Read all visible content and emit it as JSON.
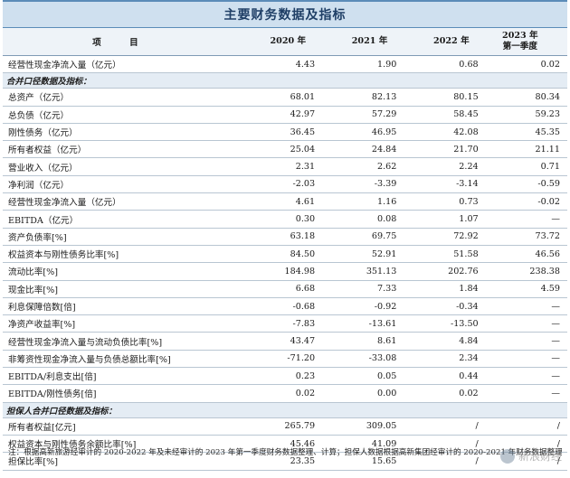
{
  "title": "主要财务数据及指标",
  "header": {
    "item": "项 目",
    "years": [
      "2020 年",
      "2021 年",
      "2022 年"
    ],
    "q_line1": "2023 年",
    "q_line2": "第一季度"
  },
  "top_row": {
    "label": "经营性现金净流入量（亿元）",
    "values": [
      "4.43",
      "1.90",
      "0.68",
      "0.02"
    ]
  },
  "section1": "合并口径数据及指标：",
  "group_a": [
    {
      "label": "总资产（亿元）",
      "values": [
        "68.01",
        "82.13",
        "80.15",
        "80.34"
      ]
    },
    {
      "label": "总负债（亿元）",
      "values": [
        "42.97",
        "57.29",
        "58.45",
        "59.23"
      ]
    },
    {
      "label": "刚性债务（亿元）",
      "values": [
        "36.45",
        "46.95",
        "42.08",
        "45.35"
      ]
    },
    {
      "label": "所有者权益（亿元）",
      "values": [
        "25.04",
        "24.84",
        "21.70",
        "21.11"
      ]
    },
    {
      "label": "营业收入（亿元）",
      "values": [
        "2.31",
        "2.62",
        "2.24",
        "0.71"
      ]
    },
    {
      "label": "净利润（亿元）",
      "values": [
        "-2.03",
        "-3.39",
        "-3.14",
        "-0.59"
      ]
    },
    {
      "label": "经营性现金净流入量（亿元）",
      "values": [
        "4.61",
        "1.16",
        "0.73",
        "-0.02"
      ]
    },
    {
      "label": "EBITDA（亿元）",
      "values": [
        "0.30",
        "0.08",
        "1.07",
        "—"
      ]
    }
  ],
  "group_b": [
    {
      "label": "资产负债率[%]",
      "values": [
        "63.18",
        "69.75",
        "72.92",
        "73.72"
      ]
    },
    {
      "label": "权益资本与刚性债务比率[%]",
      "values": [
        "84.50",
        "52.91",
        "51.58",
        "46.56"
      ]
    },
    {
      "label": "流动比率[%]",
      "values": [
        "184.98",
        "351.13",
        "202.76",
        "238.38"
      ]
    },
    {
      "label": "现金比率[%]",
      "values": [
        "6.68",
        "7.33",
        "1.84",
        "4.59"
      ]
    },
    {
      "label": "利息保障倍数[倍]",
      "values": [
        "-0.68",
        "-0.92",
        "-0.34",
        "—"
      ]
    },
    {
      "label": "净资产收益率[%]",
      "values": [
        "-7.83",
        "-13.61",
        "-13.50",
        "—"
      ]
    },
    {
      "label": "经营性现金净流入量与流动负债比率[%]",
      "values": [
        "43.47",
        "8.61",
        "4.84",
        "—"
      ]
    },
    {
      "label": "非筹资性现金净流入量与负债总额比率[%]",
      "values": [
        "-71.20",
        "-33.08",
        "2.34",
        "—"
      ]
    },
    {
      "label": "EBITDA/利息支出[倍]",
      "values": [
        "0.23",
        "0.05",
        "0.44",
        "—"
      ]
    },
    {
      "label": "EBITDA/刚性债务[倍]",
      "values": [
        "0.02",
        "0.00",
        "0.02",
        "—"
      ]
    }
  ],
  "section2": "担保人合并口径数据及指标：",
  "group_c": [
    {
      "label": "所有者权益[亿元]",
      "values": [
        "265.79",
        "309.05",
        "/",
        "/"
      ]
    },
    {
      "label": "权益资本与刚性债务余额比率[%]",
      "values": [
        "45.46",
        "41.09",
        "/",
        "/"
      ]
    },
    {
      "label": "担保比率[%]",
      "values": [
        "23.35",
        "15.65",
        "/",
        "/"
      ]
    }
  ],
  "footnote": "注：根据高新旅游经审计的 2020-2022 年及未经审计的 2023 年第一季度财务数据整理、计算；担保人数据根据高新集团经审计的 2020-2021 年财务数据整理、计算。",
  "watermark": "新浪财经"
}
